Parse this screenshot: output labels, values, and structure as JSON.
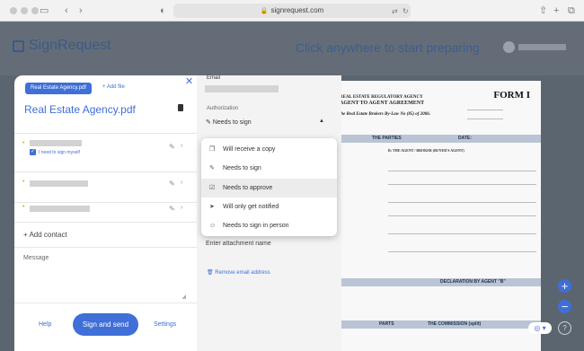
{
  "browser": {
    "url": "signrequest.com"
  },
  "app": {
    "logo_text": "SignRequest",
    "prompt": "Click anywhere to start preparing"
  },
  "sidebar": {
    "file_tag": "Real Estate Agency.pdf",
    "add_file": "+ Add file",
    "document_title": "Real Estate Agency.pdf",
    "signer_checkbox_label": "I need to sign myself",
    "add_contact": "+ Add contact",
    "message_label": "Message",
    "help": "Help",
    "sign_and_send": "Sign and send",
    "settings": "Settings"
  },
  "signer_panel": {
    "email_label": "Email",
    "authorization_label": "Authorization",
    "authorization_value": "Needs to sign",
    "attachment_placeholder": "Enter attachment name",
    "remove_email": "Remove email address"
  },
  "role_menu": {
    "items": [
      {
        "label": "Will receive a copy",
        "icon": "copy-icon"
      },
      {
        "label": "Needs to sign",
        "icon": "pen-icon"
      },
      {
        "label": "Needs to approve",
        "icon": "approve-icon",
        "highlighted": true
      },
      {
        "label": "Will only get notified",
        "icon": "send-icon"
      },
      {
        "label": "Needs to sign in person",
        "icon": "in-person-icon"
      }
    ]
  },
  "document": {
    "form_title": "FORM I",
    "header_line1": "REAL ESTATE REGULATORY AGENCY",
    "header_line2": "AGENT TO AGENT AGREEMENT",
    "header_line3": "the Real Estate Brokers By-Law No (85) of 2006.",
    "band_parties": "THE PARTIES",
    "band_date": "DATE:",
    "band_seller": "B: THE AGENT / BROKER (BUYER'S AGENT)",
    "band_declaration": "DECLARATION BY AGENT \"B\"",
    "band_commission": "THE COMMISSION (split)",
    "band_parts": "PARTS"
  },
  "colors": {
    "accent": "#3f6fd7",
    "backdrop": "#5b6570",
    "signer_dot": "#e6a814"
  }
}
